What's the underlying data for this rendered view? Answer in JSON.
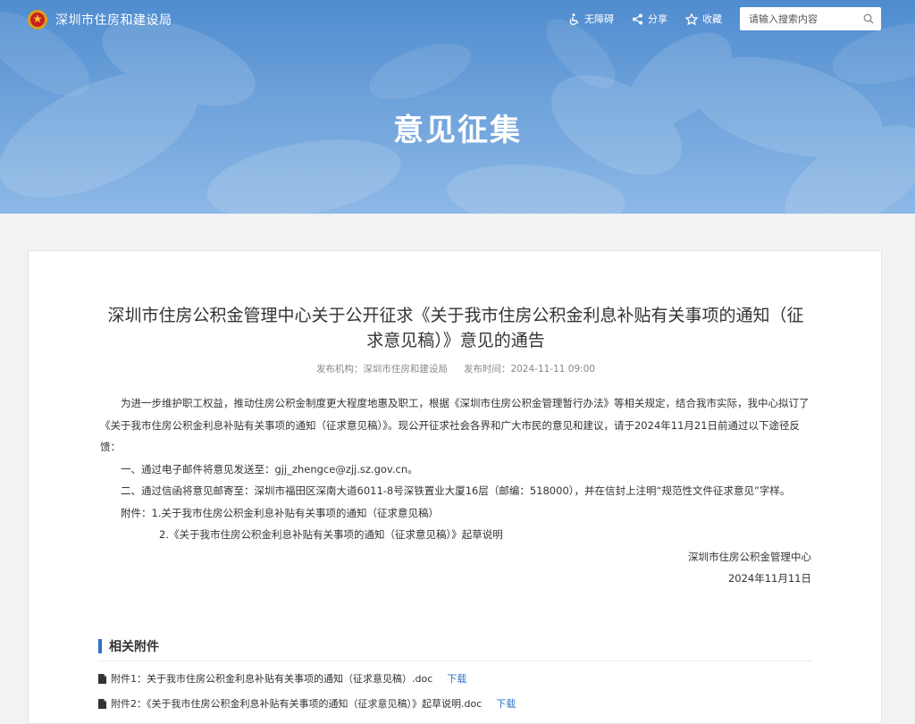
{
  "header": {
    "site_name": "深圳市住房和建设局",
    "tools": {
      "accessibility": "无障碍",
      "share": "分享",
      "favorite": "收藏"
    },
    "search": {
      "placeholder": "请输入搜索内容",
      "value": ""
    }
  },
  "banner": {
    "title": "意见征集"
  },
  "article": {
    "title": "深圳市住房公积金管理中心关于公开征求《关于我市住房公积金利息补贴有关事项的通知（征求意见稿）》意见的通告",
    "publisher_label": "发布机构：",
    "publisher": "深圳市住房和建设局",
    "time_label": "发布时间：",
    "time": "2024-11-11 09:00",
    "paragraphs": {
      "intro": "为进一步维护职工权益，推动住房公积金制度更大程度地惠及职工，根据《深圳市住房公积金管理暂行办法》等相关规定，结合我市实际，我中心拟订了《关于我市住房公积金利息补贴有关事项的通知（征求意见稿）》。现公开征求社会各界和广大市民的意见和建议，请于2024年11月21日前通过以下途径反馈：",
      "email": "一、通过电子邮件将意见发送至：gjj_zhengce@zjj.sz.gov.cn。",
      "mail": "二、通过信函将意见邮寄至：深圳市福田区深南大道6011-8号深铁置业大厦16层（邮编：518000），并在信封上注明“规范性文件征求意见”字样。",
      "attach1": "附件：1.关于我市住房公积金利息补贴有关事项的通知（征求意见稿）",
      "attach2": "2.《关于我市住房公积金利息补贴有关事项的通知（征求意见稿）》起草说明"
    },
    "signature": "深圳市住房公积金管理中心",
    "date": "2024年11月11日"
  },
  "attachments": {
    "heading": "相关附件",
    "download_label": "下载",
    "items": [
      {
        "name": "附件1：关于我市住房公积金利息补贴有关事项的通知（征求意见稿）.doc"
      },
      {
        "name": "附件2：《关于我市住房公积金利息补贴有关事项的通知（征求意见稿）》起草说明.doc"
      }
    ]
  },
  "colors": {
    "banner": "#5b95d4",
    "accent": "#2f73c7",
    "background": "#f1f2f4"
  }
}
